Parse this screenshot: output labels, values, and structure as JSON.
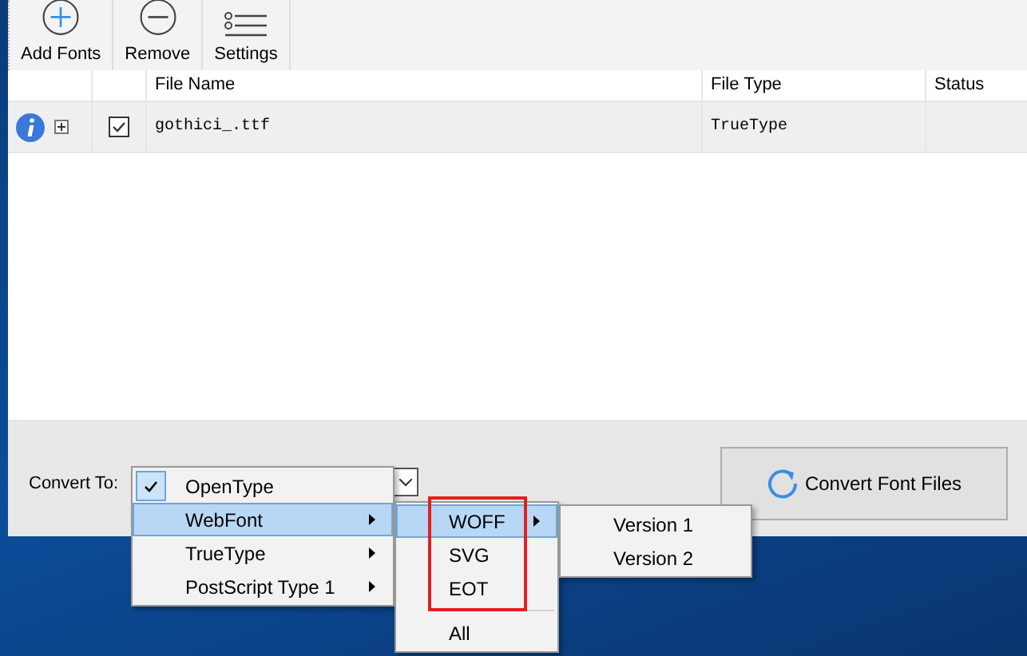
{
  "toolbar": {
    "buttons": [
      {
        "kind": "add",
        "label": "Add Fonts"
      },
      {
        "kind": "remove",
        "label": "Remove"
      },
      {
        "kind": "settings",
        "label": "Settings"
      }
    ]
  },
  "table": {
    "columns": [
      "File Name",
      "File Type",
      "Status"
    ],
    "rows": [
      {
        "checked": true,
        "expanded": false,
        "file_name": "gothici_.ttf",
        "file_type": "TrueType"
      }
    ]
  },
  "convert_to": {
    "label": "Convert To:"
  },
  "convert_button": {
    "label": "Convert Font Files"
  },
  "format_menu": {
    "items": [
      {
        "label": "OpenType",
        "checked": true,
        "selected": false,
        "has_submenu": false
      },
      {
        "label": "WebFont",
        "checked": false,
        "selected": true,
        "has_submenu": true
      },
      {
        "label": "TrueType",
        "checked": false,
        "selected": false,
        "has_submenu": true
      },
      {
        "label": "PostScript Type 1",
        "checked": false,
        "selected": false,
        "has_submenu": true
      }
    ]
  },
  "webfont_menu": {
    "items": [
      {
        "kind": "item",
        "label": "WOFF",
        "selected": true,
        "has_submenu": true
      },
      {
        "kind": "item",
        "label": "SVG",
        "selected": false,
        "has_submenu": false
      },
      {
        "kind": "item",
        "label": "EOT",
        "selected": false,
        "has_submenu": false
      },
      {
        "kind": "separator"
      },
      {
        "kind": "item",
        "label": "All",
        "selected": false,
        "has_submenu": false
      }
    ]
  },
  "woff_menu": {
    "items": [
      {
        "label": "Version 1",
        "selected": false
      },
      {
        "label": "Version 2",
        "selected": false
      }
    ]
  }
}
